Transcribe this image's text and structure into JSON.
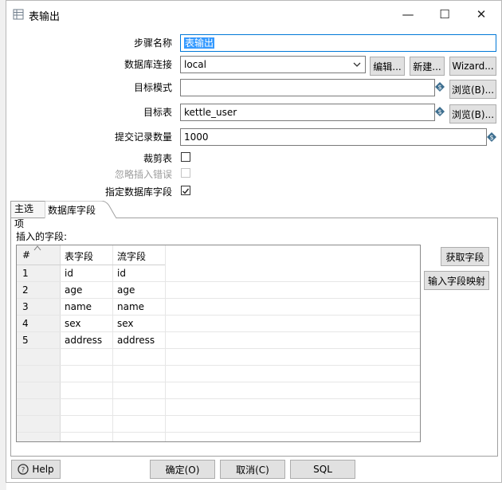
{
  "window": {
    "title": "表输出",
    "minimize": "—",
    "maximize": "☐",
    "close": "✕"
  },
  "form": {
    "step_name": {
      "label": "步骤名称",
      "value": "表输出"
    },
    "db_connection": {
      "label": "数据库连接",
      "value": "local",
      "edit_button": "编辑...",
      "new_button": "新建...",
      "wizard_button": "Wizard..."
    },
    "target_schema": {
      "label": "目标模式",
      "value": "",
      "browse_button": "浏览(B)..."
    },
    "target_table": {
      "label": "目标表",
      "value": "kettle_user",
      "browse_button": "浏览(B)..."
    },
    "commit_size": {
      "label": "提交记录数量",
      "value": "1000"
    },
    "truncate_table": {
      "label": "裁剪表",
      "checked": false
    },
    "ignore_insert_errors": {
      "label": "忽略插入错误",
      "checked": false,
      "disabled": true
    },
    "specify_db_fields": {
      "label": "指定数据库字段",
      "checked": true
    }
  },
  "tabs": [
    {
      "label": "主选项",
      "active": false
    },
    {
      "label": "数据库字段",
      "active": true
    }
  ],
  "fields_panel": {
    "title": "插入的字段:",
    "columns": [
      "#",
      "表字段",
      "流字段"
    ],
    "rows": [
      {
        "num": "1",
        "table_field": "id",
        "stream_field": "id"
      },
      {
        "num": "2",
        "table_field": "age",
        "stream_field": "age"
      },
      {
        "num": "3",
        "table_field": "name",
        "stream_field": "name"
      },
      {
        "num": "4",
        "table_field": "sex",
        "stream_field": "sex"
      },
      {
        "num": "5",
        "table_field": "address",
        "stream_field": "address"
      }
    ],
    "get_fields_button": "获取字段",
    "map_fields_button": "输入字段映射"
  },
  "footer": {
    "help_button": "Help",
    "ok_button": "确定(O)",
    "cancel_button": "取消(C)",
    "sql_button": "SQL"
  },
  "colors": {
    "accent": "#0078d7",
    "selection": "#3399ff",
    "variable_icon": "#3d6e8f"
  }
}
